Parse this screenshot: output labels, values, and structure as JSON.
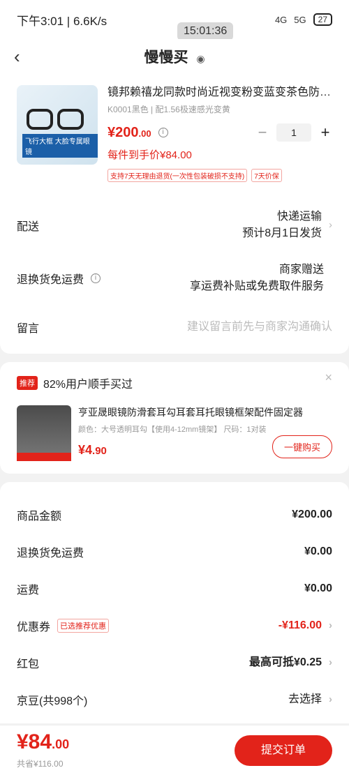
{
  "status": {
    "time": "下午3:01 | 6.6K/s",
    "net1": "4G",
    "net2": "5G",
    "battery": "27"
  },
  "overlay_time": "15:01:36",
  "nav": {
    "back": "‹",
    "title": "慢慢买"
  },
  "product": {
    "title": "镜邦赖禧龙同款时尚近视变粉变蓝变茶色防蓝光眼镜",
    "spec": "K0001黑色 | 配1.56极速感光变黄",
    "price_main": "¥200",
    "price_cents": ".00",
    "qty": "1",
    "unit_price": "每件到手价¥84.00",
    "tags": [
      "支持7天无理由退货(一次性包装破损不支持)",
      "7天价保"
    ],
    "thumb_label": "飞行大框 大脸专属眼镜"
  },
  "delivery": {
    "label": "配送",
    "line1": "快递运输",
    "line2": "预计8月1日发货"
  },
  "freight": {
    "label": "退换货免运费",
    "line1": "商家赠送",
    "line2": "享运费补贴或免费取件服务"
  },
  "note": {
    "label": "留言",
    "placeholder": "建议留言前先与商家沟通确认"
  },
  "recommend": {
    "badge": "推荐",
    "headline": "82%用户顺手买过",
    "title": "亨亚晟眼镜防滑套耳勾耳套耳托眼镜框架配件固定器",
    "spec": "颜色：大号透明耳勾【使用4-12mm镜架】   尺码：1对装",
    "price_main": "¥4",
    "price_cents": ".90",
    "buy": "一键购买"
  },
  "summary": {
    "goods_label": "商品金额",
    "goods_val": "¥200.00",
    "freight_free_label": "退换货免运费",
    "freight_free_val": "¥0.00",
    "shipping_label": "运费",
    "shipping_val": "¥0.00",
    "coupon_label": "优惠券",
    "coupon_tag": "已选推荐优惠",
    "coupon_val": "-¥116.00",
    "hongbao_label": "红包",
    "hongbao_val": "最高可抵¥0.25",
    "jingdou_label": "京豆(共998个)",
    "jingdou_val": "去选择"
  },
  "bottom": {
    "total_main": "¥84",
    "total_cents": ".00",
    "total_sub": "共省¥116.00",
    "submit": "提交订单"
  },
  "colors": {
    "accent": "#e2231a"
  }
}
